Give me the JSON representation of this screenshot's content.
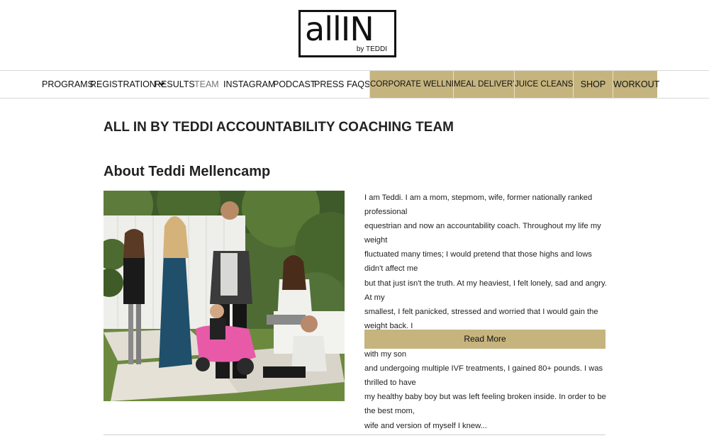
{
  "brand": {
    "logo_main": "allIN",
    "logo_sub": "by TEDDI"
  },
  "nav": {
    "items": [
      {
        "label": "PROGRAMS"
      },
      {
        "label": "REGISTRATION"
      },
      {
        "label": "RESULTS"
      },
      {
        "label": "TEAM"
      },
      {
        "label": "INSTAGRAM"
      },
      {
        "label": "PODCAST"
      },
      {
        "label": "PRESS"
      },
      {
        "label": "FAQS"
      }
    ],
    "highlighted": [
      {
        "label": "CORPORATE WELLNESS"
      },
      {
        "label": "MEAL DELIVERY"
      },
      {
        "label": "JUICE CLEANSE"
      },
      {
        "label": "SHOP"
      },
      {
        "label": "WORKOUT"
      }
    ]
  },
  "main": {
    "page_title": "ALL IN BY TEDDI ACCOUNTABILITY COACHING TEAM",
    "section_title": "About Teddi Mellencamp",
    "bio_lines": [
      "I am Teddi. I am a mom, stepmom, wife, former nationally ranked professional",
      "equestrian and now an accountability coach. Throughout my life my weight",
      "fluctuated many times; I would pretend that those highs and lows didn't affect me",
      "but that just isn't the truth. At my heaviest, I felt lonely, sad and angry. At my",
      "smallest, I felt panicked, stressed and worried that I would gain the weight back. I",
      "very rarely felt great in my own skin. After struggling to get pregnant with my son",
      "and undergoing multiple IVF treatments, I gained 80+ pounds. I was thrilled to have",
      "my healthy baby boy but was left feeling broken inside. In order to be the best mom,",
      "wife and version of myself I knew..."
    ],
    "read_more_label": "Read More"
  },
  "colors": {
    "accent_gold": "#c5b47e",
    "text": "#222222",
    "nav_dim": "#777777"
  }
}
